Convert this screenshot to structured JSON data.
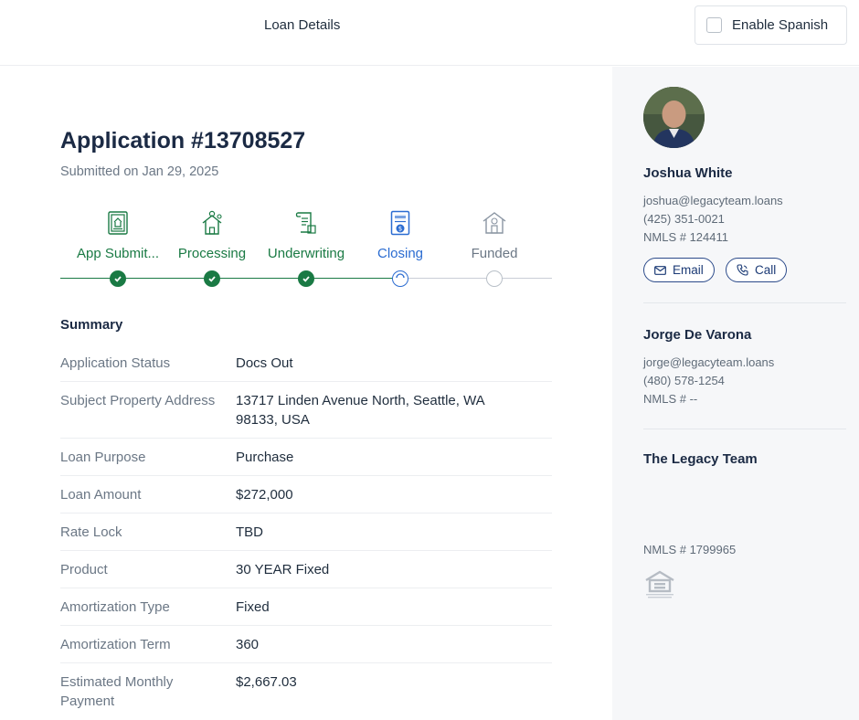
{
  "header": {
    "tab": "Loan Details",
    "spanish_label": "Enable Spanish"
  },
  "application": {
    "title": "Application #13708527",
    "submitted": "Submitted on Jan 29, 2025"
  },
  "steps": [
    {
      "label": "App Submit...",
      "state": "done",
      "icon": "application-document-icon"
    },
    {
      "label": "Processing",
      "state": "done",
      "icon": "house-gear-icon"
    },
    {
      "label": "Underwriting",
      "state": "done",
      "icon": "scroll-document-icon"
    },
    {
      "label": "Closing",
      "state": "current",
      "icon": "closing-document-icon"
    },
    {
      "label": "Funded",
      "state": "pending",
      "icon": "house-dollar-icon"
    }
  ],
  "summary": {
    "heading": "Summary",
    "rows": [
      {
        "key": "Application Status",
        "value": "Docs Out"
      },
      {
        "key": "Subject Property Address",
        "value": "13717 Linden Avenue North, Seattle, WA 98133, USA"
      },
      {
        "key": "Loan Purpose",
        "value": "Purchase"
      },
      {
        "key": "Loan Amount",
        "value": "$272,000"
      },
      {
        "key": "Rate Lock",
        "value": "TBD"
      },
      {
        "key": "Product",
        "value": "30 YEAR Fixed"
      },
      {
        "key": "Amortization Type",
        "value": "Fixed"
      },
      {
        "key": "Amortization Term",
        "value": "360"
      },
      {
        "key": "Estimated Monthly Payment",
        "value": "$2,667.03"
      }
    ]
  },
  "contacts": {
    "primary": {
      "name": "Joshua White",
      "email": "joshua@legacyteam.loans",
      "phone": "(425) 351-0021",
      "nmls": "NMLS # 124411",
      "email_button": "Email",
      "call_button": "Call"
    },
    "secondary": {
      "name": "Jorge De Varona",
      "email": "jorge@legacyteam.loans",
      "phone": "(480) 578-1254",
      "nmls": "NMLS # --"
    },
    "team": {
      "name": "The Legacy Team",
      "nmls": "NMLS # 1799965",
      "logo_icon": "equal-housing-lender-icon"
    }
  },
  "colors": {
    "done": "#1a7a44",
    "current": "#2b6cd1",
    "pending": "#6b7785",
    "heading": "#1b2a44",
    "side_bg": "#f6f7f9"
  }
}
